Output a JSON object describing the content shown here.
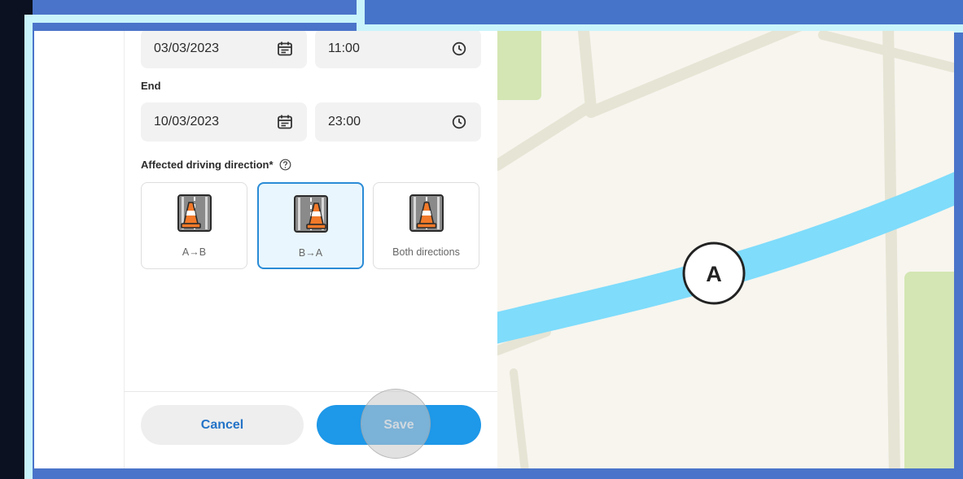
{
  "start": {
    "date": "03/03/2023",
    "time": "11:00"
  },
  "end": {
    "label": "End",
    "date": "10/03/2023",
    "time": "23:00"
  },
  "direction": {
    "label": "Affected driving direction*",
    "options": [
      {
        "label": "A→B",
        "selected": false
      },
      {
        "label": "B→A",
        "selected": true
      },
      {
        "label": "Both directions",
        "selected": false
      }
    ]
  },
  "buttons": {
    "cancel": "Cancel",
    "save": "Save"
  },
  "map": {
    "marker_label": "A"
  },
  "icons": [
    "calendar-icon",
    "clock-icon",
    "help-icon",
    "traffic-cone-icon"
  ],
  "colors": {
    "accent": "#1e98e8",
    "selected_border": "#2a8bd6",
    "route": "#7fdcfb",
    "cone": "#f27a2a"
  }
}
